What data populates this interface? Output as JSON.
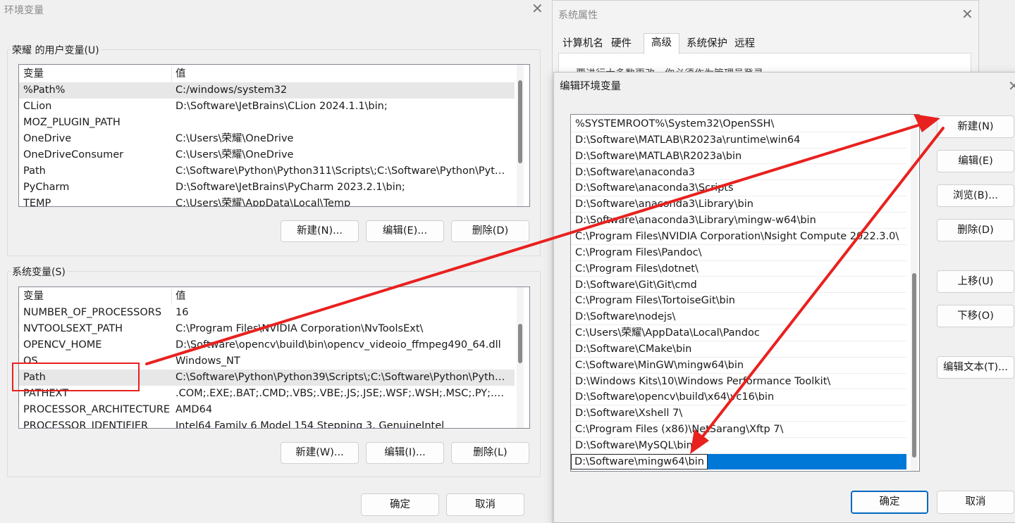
{
  "env_window": {
    "title": "环境变量",
    "user_group_label": "荣耀 的用户变量(U)",
    "user_headers": [
      "变量",
      "值"
    ],
    "user_vars": [
      {
        "name": "%Path%",
        "value": " C:/windows/system32"
      },
      {
        "name": "CLion",
        "value": "D:\\Software\\JetBrains\\CLion 2024.1.1\\bin;"
      },
      {
        "name": "MOZ_PLUGIN_PATH",
        "value": ""
      },
      {
        "name": "OneDrive",
        "value": "C:\\Users\\荣耀\\OneDrive"
      },
      {
        "name": "OneDriveConsumer",
        "value": "C:\\Users\\荣耀\\OneDrive"
      },
      {
        "name": "Path",
        "value": "C:\\Software\\Python\\Python311\\Scripts\\;C:\\Software\\Python\\Pytho..."
      },
      {
        "name": "PyCharm",
        "value": "D:\\Software\\JetBrains\\PyCharm 2023.2.1\\bin;"
      },
      {
        "name": "TEMP",
        "value": "C:\\Users\\荣耀\\AppData\\Local\\Temp"
      }
    ],
    "user_buttons": {
      "new": "新建(N)...",
      "edit": "编辑(E)...",
      "delete": "删除(D)"
    },
    "system_group_label": "系统变量(S)",
    "system_headers": [
      "变量",
      "值"
    ],
    "system_vars": [
      {
        "name": "NUMBER_OF_PROCESSORS",
        "value": "16"
      },
      {
        "name": "NVTOOLSEXT_PATH",
        "value": "C:\\Program Files\\NVIDIA Corporation\\NvToolsExt\\"
      },
      {
        "name": "OPENCV_HOME",
        "value": "D:\\Software\\opencv\\build\\bin\\opencv_videoio_ffmpeg490_64.dll"
      },
      {
        "name": "OS",
        "value": "Windows_NT"
      },
      {
        "name": "Path",
        "value": "C:\\Software\\Python\\Python39\\Scripts\\;C:\\Software\\Python\\Python..."
      },
      {
        "name": "PATHEXT",
        "value": ".COM;.EXE;.BAT;.CMD;.VBS;.VBE;.JS;.JSE;.WSF;.WSH;.MSC;.PY;.PYW"
      },
      {
        "name": "PROCESSOR_ARCHITECTURE",
        "value": "AMD64"
      },
      {
        "name": "PROCESSOR_IDENTIFIER",
        "value": "Intel64 Family 6 Model 154 Stepping 3, GenuineIntel"
      }
    ],
    "system_buttons": {
      "new": "新建(W)...",
      "edit": "编辑(I)...",
      "delete": "删除(L)"
    },
    "ok": "确定",
    "cancel": "取消"
  },
  "sys_window": {
    "title": "系统属性",
    "tabs": [
      "计算机名",
      "硬件",
      "高级",
      "系统保护",
      "远程"
    ],
    "active_tab": "高级",
    "partial_text": "要进行大多数更改，你必须作为管理员登录"
  },
  "edit_window": {
    "title": "编辑环境变量",
    "paths": [
      "%SYSTEMROOT%\\System32\\OpenSSH\\",
      "D:\\Software\\MATLAB\\R2023a\\runtime\\win64",
      "D:\\Software\\MATLAB\\R2023a\\bin",
      "D:\\Software\\anaconda3",
      "D:\\Software\\anaconda3\\Scripts",
      "D:\\Software\\anaconda3\\Library\\bin",
      "D:\\Software\\anaconda3\\Library\\mingw-w64\\bin",
      "C:\\Program Files\\NVIDIA Corporation\\Nsight Compute 2022.3.0\\",
      "C:\\Program Files\\Pandoc\\",
      "C:\\Program Files\\dotnet\\",
      "D:\\Software\\Git\\Git\\cmd",
      "C:\\Program Files\\TortoiseGit\\bin",
      "D:\\Software\\nodejs\\",
      "C:\\Users\\荣耀\\AppData\\Local\\Pandoc",
      "D:\\Software\\CMake\\bin",
      "C:\\Software\\MinGW\\mingw64\\bin",
      "D:\\Windows Kits\\10\\Windows Performance Toolkit\\",
      "D:\\Software\\opencv\\build\\x64\\vc16\\bin",
      "D:\\Software\\Xshell 7\\",
      "C:\\Program Files (x86)\\NetSarang\\Xftp 7\\",
      "D:\\Software\\MySQL\\bin"
    ],
    "editing_value": "D:\\Software\\mingw64\\bin",
    "buttons": {
      "new": "新建(N)",
      "edit": "编辑(E)",
      "browse": "浏览(B)...",
      "delete": "删除(D)",
      "up": "上移(U)",
      "down": "下移(O)",
      "edit_text": "编辑文本(T)..."
    },
    "ok": "确定",
    "cancel": "取消"
  },
  "annotation_color": "#e8211f"
}
